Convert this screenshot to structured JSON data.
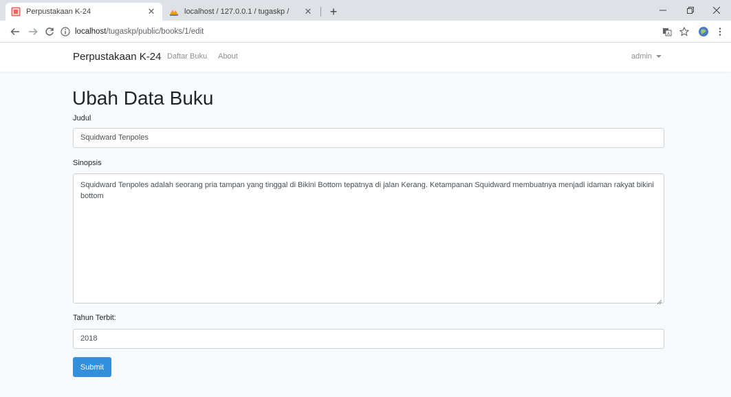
{
  "browser": {
    "tabs": [
      {
        "title": "Perpustakaan K-24",
        "active": true
      },
      {
        "title": "localhost / 127.0.0.1 / tugaskp / ",
        "active": false
      }
    ],
    "new_tab_label": "+",
    "url_host": "localhost",
    "url_path": "/tugaskp/public/books/1/edit",
    "icons": [
      "back-arrow-icon",
      "forward-arrow-icon",
      "reload-icon",
      "info-icon",
      "translate-icon",
      "star-icon",
      "profile-icon",
      "kebab-menu-icon"
    ]
  },
  "navbar": {
    "brand": "Perpustakaan K-24",
    "links": [
      "Daftar Buku",
      "About"
    ],
    "user": "admin"
  },
  "form": {
    "title": "Ubah Data Buku",
    "judul_label": "Judul",
    "judul_value": "Squidward Tenpoles",
    "sinopsis_label": "Sinopsis",
    "sinopsis_value": "Squidward Tenpoles adalah seorang pria tampan yang tinggal di Bikini Bottom tepatnya di jalan Kerang. Ketampanan Squidward membuatnya menjadi idaman rakyat bikini bottom",
    "tahun_label": "Tahun Terbit:",
    "tahun_value": "2018",
    "submit_label": "Submit"
  },
  "colors": {
    "primary": "#3490dc",
    "page_bg": "#f8fafc",
    "tabstrip_bg": "#dee1e6"
  }
}
